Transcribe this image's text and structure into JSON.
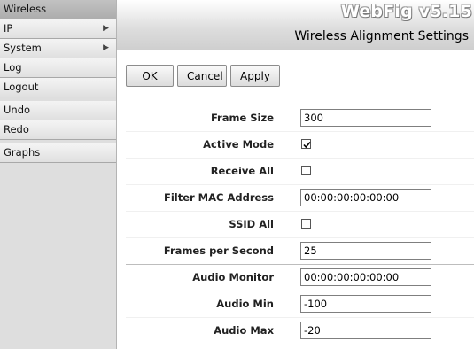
{
  "sidebar": {
    "items": [
      {
        "label": "Wireless",
        "has_submenu": false,
        "active": true
      },
      {
        "label": "IP",
        "has_submenu": true,
        "arrow": "▶"
      },
      {
        "label": "System",
        "has_submenu": true,
        "arrow": "▶"
      },
      {
        "label": "Log",
        "has_submenu": false
      },
      {
        "label": "Logout",
        "has_submenu": false
      },
      {
        "label": "Undo",
        "has_submenu": false
      },
      {
        "label": "Redo",
        "has_submenu": false
      },
      {
        "label": "Graphs",
        "has_submenu": false
      }
    ]
  },
  "header": {
    "brand": "WebFig v5.15",
    "page_title": "Wireless Alignment Settings"
  },
  "toolbar": {
    "ok_label": "OK",
    "cancel_label": "Cancel",
    "apply_label": "Apply"
  },
  "form": {
    "frame_size": {
      "label": "Frame Size",
      "value": "300"
    },
    "active_mode": {
      "label": "Active Mode",
      "checked": true
    },
    "receive_all": {
      "label": "Receive All",
      "checked": false
    },
    "filter_mac": {
      "label": "Filter MAC Address",
      "value": "00:00:00:00:00:00"
    },
    "ssid_all": {
      "label": "SSID All",
      "checked": false
    },
    "frames_per_second": {
      "label": "Frames per Second",
      "value": "25"
    },
    "audio_monitor": {
      "label": "Audio Monitor",
      "value": "00:00:00:00:00:00"
    },
    "audio_min": {
      "label": "Audio Min",
      "value": "-100"
    },
    "audio_max": {
      "label": "Audio Max",
      "value": "-20"
    }
  },
  "colors": {
    "sidebar_bg": "#dedede",
    "active_item": "#b8b8b8",
    "header_gradient_end": "#cfcfcf"
  },
  "icons": {
    "submenu_arrow": "submenu-arrow-icon",
    "checkmark": "checkmark-icon"
  }
}
